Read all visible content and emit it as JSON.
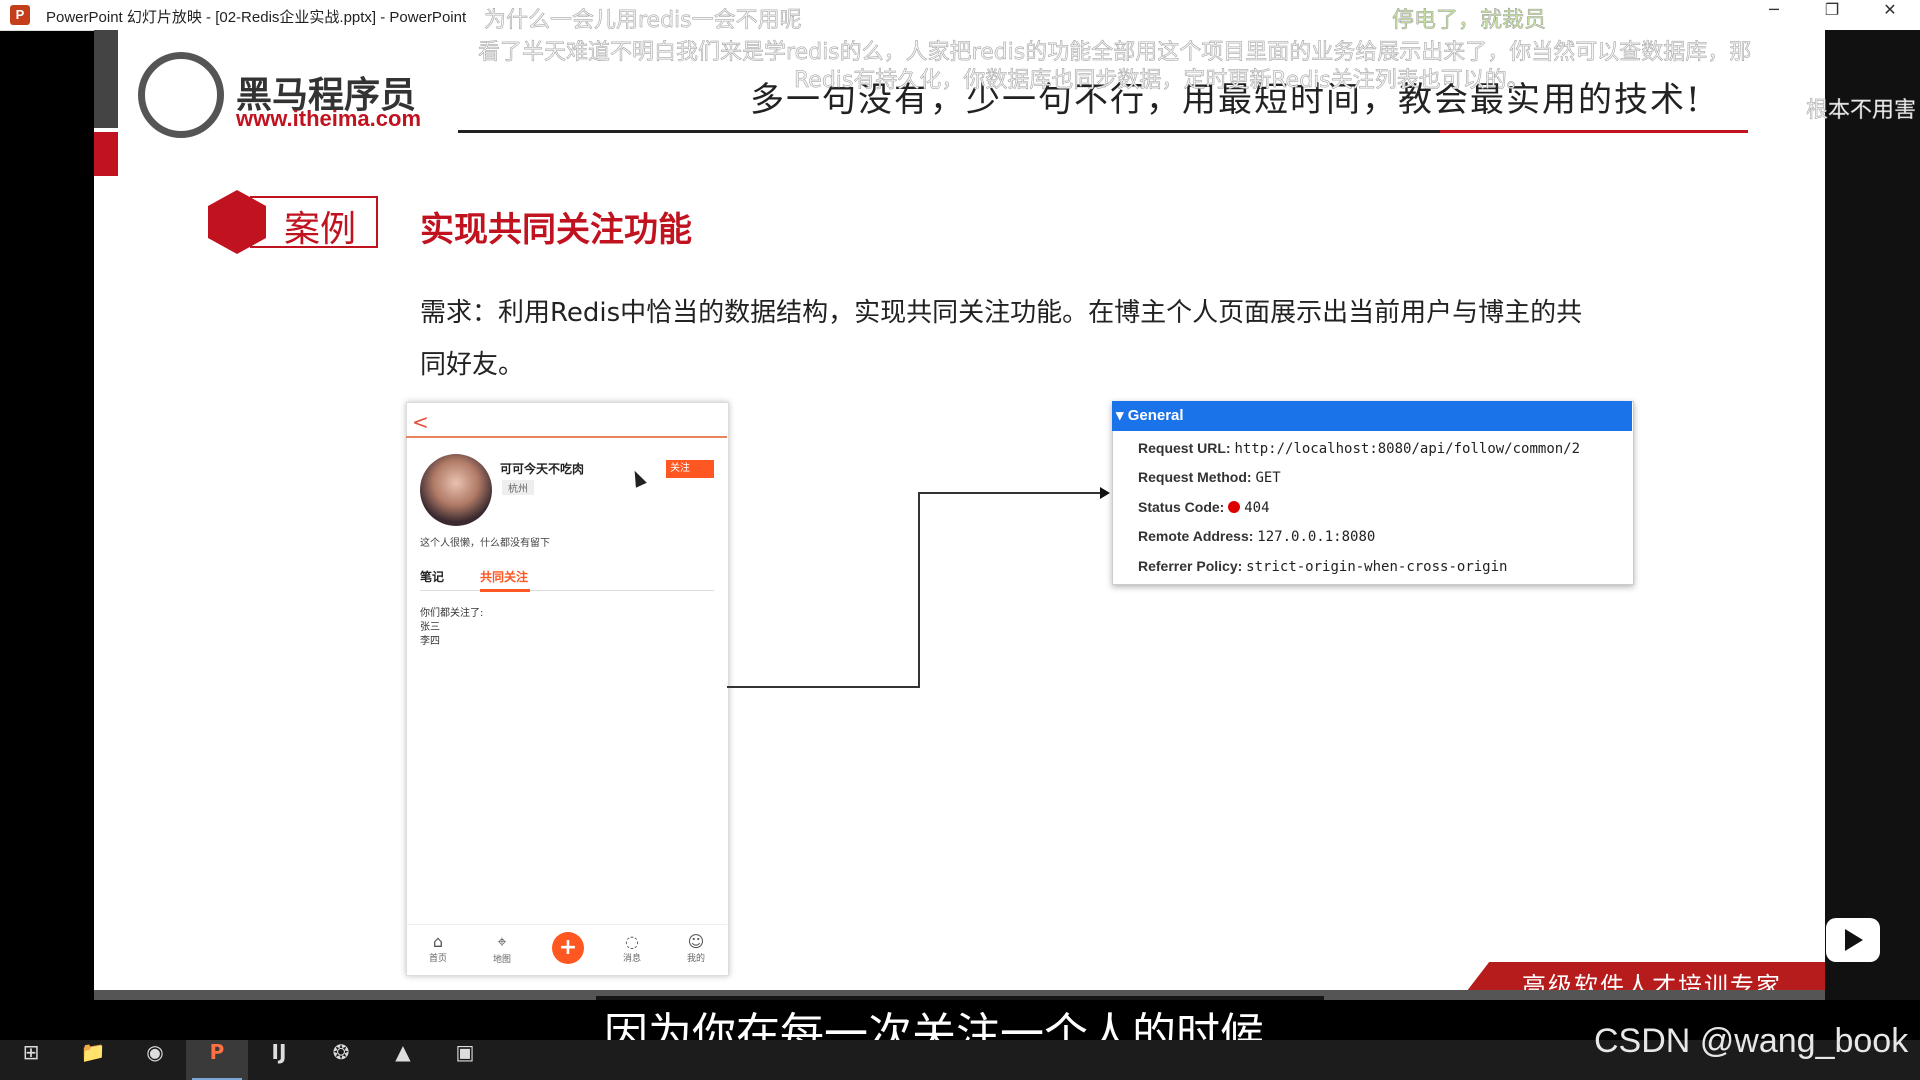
{
  "window": {
    "app_icon": "P",
    "title": "PowerPoint 幻灯片放映 - [02-Redis企业实战.pptx] - PowerPoint",
    "minimize_icon": "─",
    "restore_icon": "❐",
    "close_icon": "✕"
  },
  "slide": {
    "logo_name": "黑马程序员",
    "logo_url": "www.itheima.com",
    "slogan": "多一句没有，少一句不行，用最短时间，教会最实用的技术!",
    "case_label": "案例",
    "title": "实现共同关注功能",
    "requirement_line1": "需求：利用Redis中恰当的数据结构，实现共同关注功能。在博主个人页面展示出当前用户与博主的共",
    "requirement_line2": "同好友。",
    "bottom_slogan": "高级软件人才培训专家"
  },
  "phone": {
    "back": "<",
    "name": "可可今天不吃肉",
    "city": "杭州",
    "follow_button": "关注",
    "bio": "这个人很懒，什么都没有留下",
    "tabs": [
      "笔记",
      "共同关注"
    ],
    "active_tab": "共同关注",
    "list_title": "你们都关注了:",
    "list_items": [
      "张三",
      "李四"
    ],
    "nav": [
      "首页",
      "地图",
      "消息",
      "我的"
    ],
    "add_button": "+"
  },
  "devtools": {
    "header": "▾ General",
    "rows": [
      {
        "label": "Request URL:",
        "value": "http://localhost:8080/api/follow/common/2"
      },
      {
        "label": "Request Method:",
        "value": "GET"
      },
      {
        "label": "Status Code:",
        "value": "404"
      },
      {
        "label": "Remote Address:",
        "value": "127.0.0.1:8080"
      },
      {
        "label": "Referrer Policy:",
        "value": "strict-origin-when-cross-origin"
      }
    ],
    "status_color": "#dd0000"
  },
  "overlay": {
    "danmaku": [
      "为什么一会儿用redis一会不用呢",
      "停电了，就裁员",
      "看了半天难道不明白我们来是学redis的么，人家把redis的功能全部用这个项目里面的业务给展示出来了，你当然可以查数据库，那",
      "Redis有持久化，你数据库也同步数据，定时更新Redis关注列表也可以的。",
      "根本不用害"
    ],
    "subtitle": "因为你在每一次关注一个人的时候",
    "watermark": "CSDN @wang_book"
  },
  "taskbar": {
    "items": [
      "⊞",
      "📁",
      "◉",
      "P",
      "IJ",
      "❂",
      "▲",
      "▣"
    ]
  }
}
